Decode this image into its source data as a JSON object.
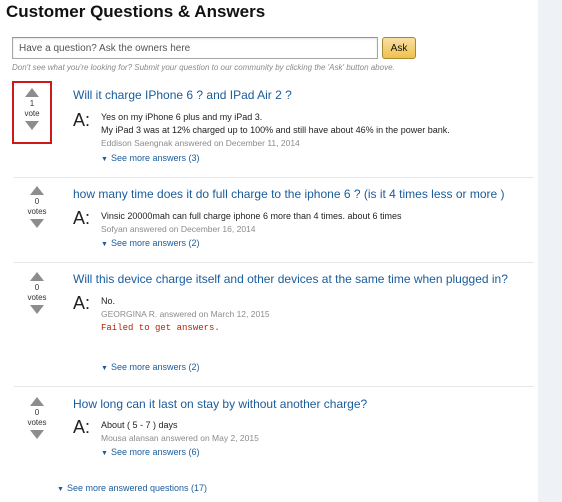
{
  "page": {
    "title": "Customer Questions & Answers"
  },
  "search": {
    "placeholder": "Have a question? Ask the owners here",
    "ask_label": "Ask",
    "hint": "Don't see what you're looking for? Submit your question to our community by clicking the 'Ask' button above."
  },
  "questions": [
    {
      "votes": "1",
      "votes_label": "vote",
      "question": "Will it charge IPhone 6 ? and IPad Air 2 ?",
      "answer_lines": [
        "Yes on my iPhone 6 plus and my iPad 3.",
        "My iPad 3 was at 12% charged up to 100% and still have about 46% in the power bank."
      ],
      "meta": "Eddison Saengnak answered on December 11, 2014",
      "see_more": "See more answers (3)"
    },
    {
      "votes": "0",
      "votes_label": "votes",
      "question": "how many time does it do full charge to the iphone 6 ? (is it 4 times less or more )",
      "answer_lines": [
        "Vinsic 20000mah can full charge iphone 6 more than 4 times. about 6 times"
      ],
      "meta": "Sofyan answered on December 16, 2014",
      "see_more": "See more answers (2)"
    },
    {
      "votes": "0",
      "votes_label": "votes",
      "question": "Will this device charge itself and other devices at the same time when plugged in?",
      "answer_lines": [
        "No."
      ],
      "meta": "GEORGINA R. answered on March 12, 2015",
      "error": "Failed to get answers.",
      "see_more": "See more answers (2)"
    },
    {
      "votes": "0",
      "votes_label": "votes",
      "question": "How long can it last on stay by without another charge?",
      "answer_lines": [
        "About ( 5 - 7 ) days"
      ],
      "meta": "Mousa alansan answered on May 2, 2015",
      "see_more": "See more answers (6)"
    }
  ],
  "answer_marker": "A:",
  "footer": {
    "see_more_questions": "See more answered questions (17)"
  },
  "icons": {
    "upvote": "upvote-icon",
    "downvote": "downvote-icon",
    "expand": "chevron-down-icon"
  },
  "colors": {
    "link": "#1a5c9c",
    "highlight": "#cc1a1a",
    "ask_button": "#f0c14b",
    "error": "#b12704"
  }
}
